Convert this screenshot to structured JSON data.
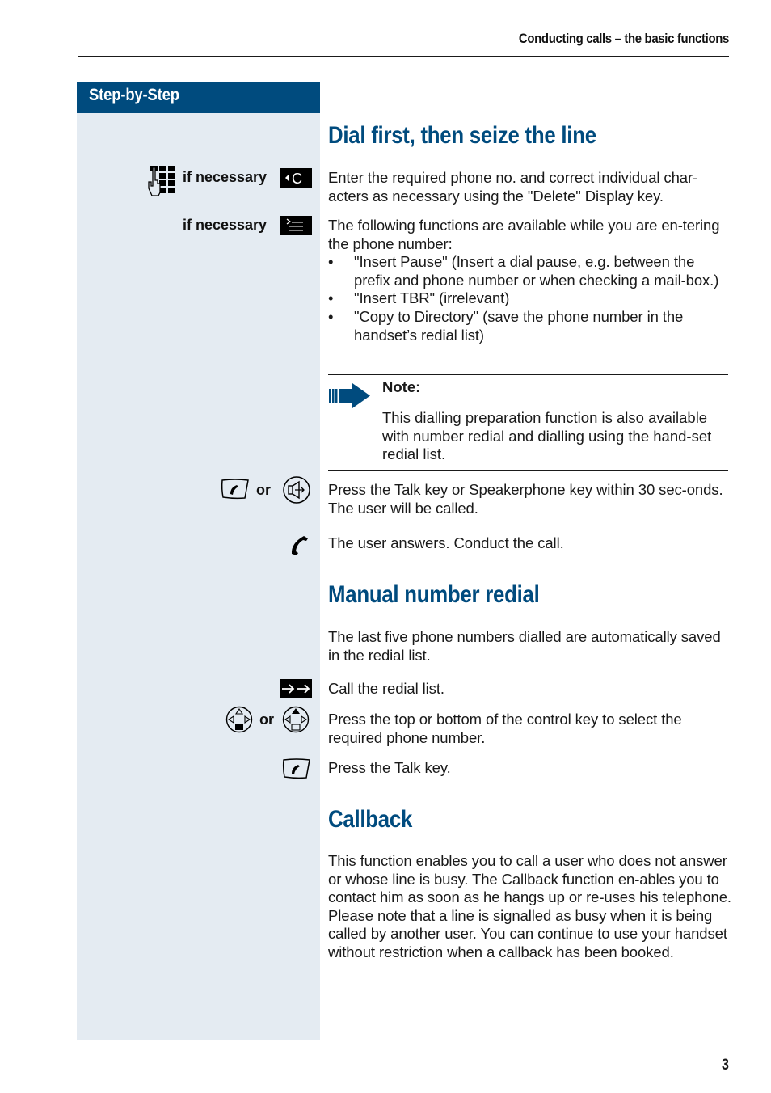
{
  "header": {
    "running_title": "Conducting calls – the basic functions"
  },
  "sidebar": {
    "title": "Step-by-Step"
  },
  "sections": {
    "dial_first": {
      "heading": "Dial first, then seize the line",
      "steps": [
        {
          "label": "if necessary",
          "icons": [
            "keypad-icon",
            "delete-key-icon"
          ],
          "text": "Enter the required phone no. and correct individual char-acters as necessary using the \"Delete\" Display key."
        },
        {
          "label": "if necessary",
          "icons": [
            "menu-key-icon"
          ],
          "text": "The following functions are available while you are en-tering the phone number:",
          "bullets": [
            "\"Insert Pause\" (Insert a dial pause, e.g.  between the prefix and phone number or when checking a mail-box.)",
            "\"Insert TBR\" (irrelevant)",
            "\"Copy to Directory\" (save the phone number in the handset’s redial list)"
          ]
        }
      ],
      "note": {
        "title": "Note:",
        "text": "This dialling preparation function is also available with number redial and dialling using the hand-set redial list."
      },
      "step_talk": {
        "or_label": "or",
        "icons": [
          "talk-key-icon",
          "speakerphone-key-icon"
        ],
        "text": "Press the Talk key or Speakerphone key within 30 sec-onds. The user will be called."
      },
      "step_answer": {
        "icons": [
          "handset-icon"
        ],
        "text": "The user answers. Conduct the call."
      }
    },
    "manual_redial": {
      "heading": "Manual number redial",
      "intro": "The last five phone numbers dialled are automatically saved in the redial list.",
      "step_list": {
        "icons": [
          "redial-key-icon"
        ],
        "text": "Call the redial list."
      },
      "step_select": {
        "or_label": "or",
        "icons": [
          "control-key-down-icon",
          "control-key-up-icon"
        ],
        "text": "Press the top or bottom of the control key to select the required phone number."
      },
      "step_talk": {
        "icons": [
          "talk-key-icon"
        ],
        "text": "Press the Talk key."
      }
    },
    "callback": {
      "heading": "Callback",
      "text": "This function enables you to call a user who does not answer or whose line is busy. The Callback function en-ables you to contact him as soon as he hangs up or re-uses his telephone. Please note that a line is signalled as busy when it is being called by another user. You can continue to use your handset without restriction when a callback has been booked."
    }
  },
  "footer": {
    "page_number": "3"
  },
  "colors": {
    "accent": "#004b7e",
    "sidebar_bg": "#e4ebf2"
  }
}
